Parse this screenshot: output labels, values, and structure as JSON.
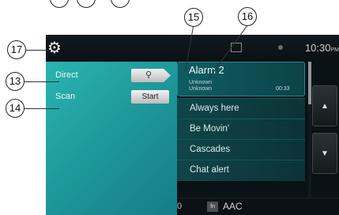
{
  "callouts": {
    "c15": "15",
    "c16": "16",
    "c17": "17",
    "c13": "13",
    "c14": "14"
  },
  "status": {
    "time": "10:30",
    "ampm": "PM"
  },
  "menu": {
    "direct_label": "Direct",
    "scan_label": "Scan",
    "start_label": "Start",
    "search_icon": "⚲"
  },
  "playlist": {
    "active_title": "Alarm 2",
    "active_artist": "Unknown",
    "active_album": "Unknown",
    "active_time": "00:33",
    "items": [
      "Always here",
      "Be Movin'",
      "Cascades",
      "Chat alert"
    ]
  },
  "bottom": {
    "format_badge": "fn",
    "format_label": "AAC",
    "left_digit": "0"
  },
  "scroll": {
    "up": "▲",
    "down": "▼"
  }
}
